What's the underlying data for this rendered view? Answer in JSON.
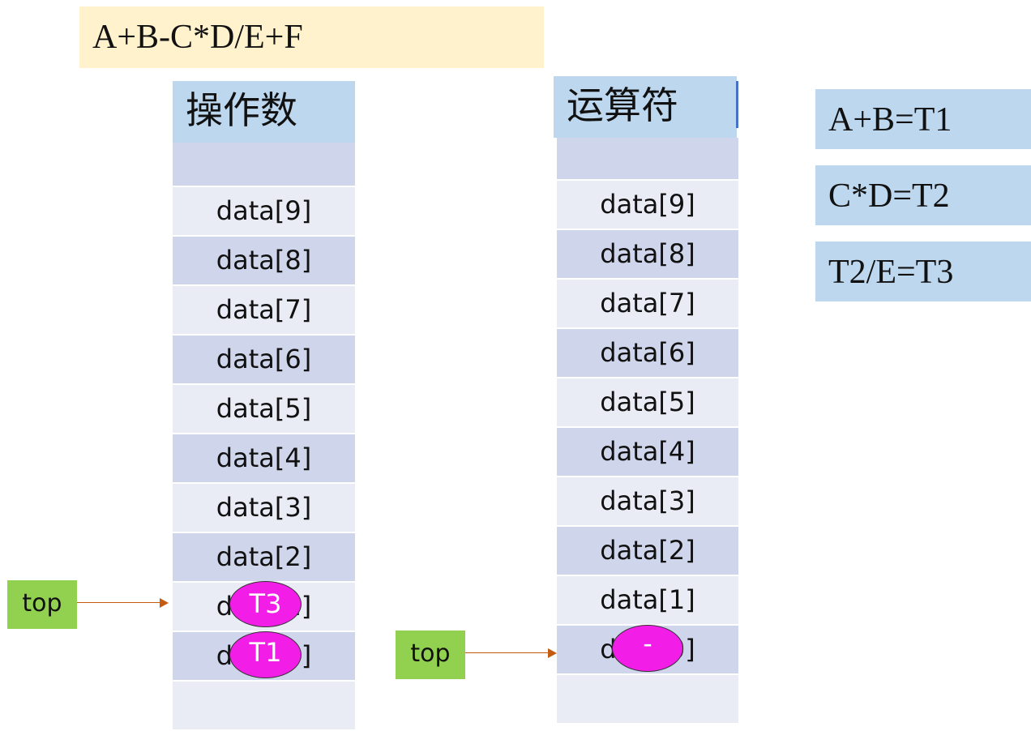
{
  "expression": "A+B-C*D/E+F",
  "operand_stack": {
    "title": "操作数",
    "top_cell_empty": "",
    "cells": [
      "data[9]",
      "data[8]",
      "data[7]",
      "data[6]",
      "data[5]",
      "data[4]",
      "data[3]",
      "data[2]",
      "data[1]",
      "data[0]"
    ],
    "bottom_cell_empty": "",
    "pushed_values": [
      {
        "slot": "data[1]",
        "value": "T3"
      },
      {
        "slot": "data[0]",
        "value": "T1"
      }
    ],
    "top_pointer_label": "top",
    "top_points_to": "data[1]"
  },
  "operator_stack": {
    "title": "运算符",
    "top_cell_empty": "",
    "cells": [
      "data[9]",
      "data[8]",
      "data[7]",
      "data[6]",
      "data[5]",
      "data[4]",
      "data[3]",
      "data[2]",
      "data[1]",
      "data[0]"
    ],
    "bottom_cell_empty": "",
    "pushed_values": [
      {
        "slot": "data[0]",
        "value": "-"
      }
    ],
    "top_pointer_label": "top",
    "top_points_to": "data[0]"
  },
  "results": [
    "A+B=T1",
    "C*D=T2",
    "T2/E=T3"
  ],
  "colors": {
    "expression_bg": "#fff2cc",
    "header_bg": "#bdd7ee",
    "cell_dark": "#cfd5ea",
    "cell_light": "#e9ebf5",
    "top_label_bg": "#92d050",
    "arrow": "#c55a11",
    "value_ellipse": "#f31de8"
  }
}
